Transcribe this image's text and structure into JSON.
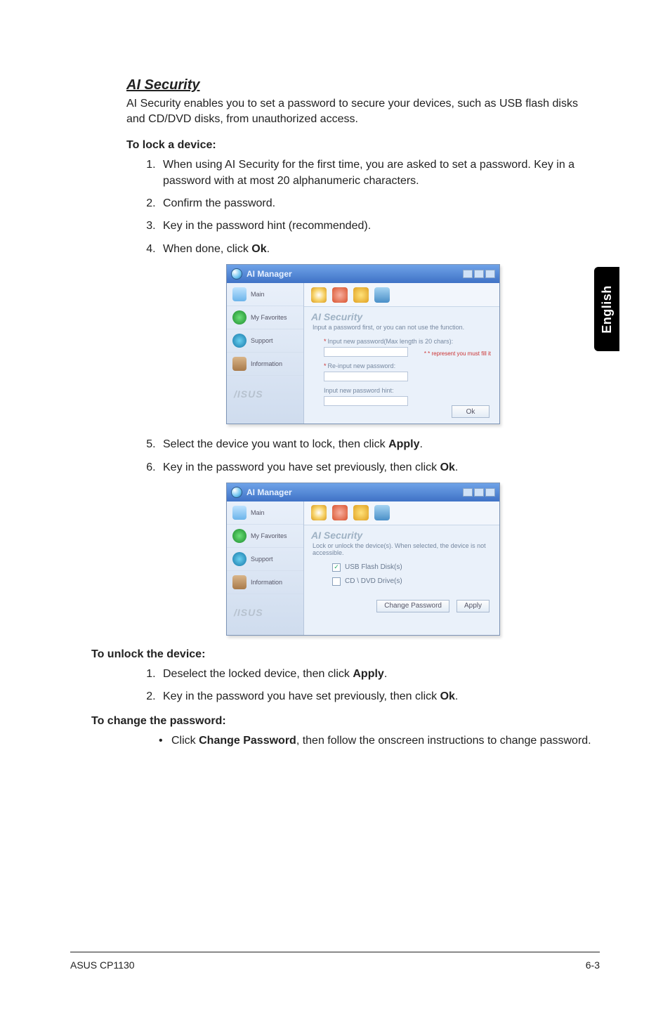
{
  "side_tab": "English",
  "heading": "AI Security",
  "intro": "AI Security enables you to set a password to secure your devices, such as USB flash disks and CD/DVD disks, from unauthorized access.",
  "lock": {
    "title": "To lock a device:",
    "step1": "When using AI Security for the first time, you are asked to set a password. Key in a password with at most 20 alphanumeric characters.",
    "step2": "Confirm the password.",
    "step3": "Key in the password hint (recommended).",
    "step4_pre": "When done, click ",
    "step4_b": "Ok",
    "step4_post": ".",
    "step5_pre": "Select the device you want to lock, then click ",
    "step5_b": "Apply",
    "step5_post": ".",
    "step6_pre": "Key in the password you have set previously, then click ",
    "step6_b": "Ok",
    "step6_post": "."
  },
  "unlock": {
    "title": "To unlock the device:",
    "step1_pre": "Deselect the locked device, then click ",
    "step1_b": "Apply",
    "step1_post": ".",
    "step2_pre": "Key in the password you have set previously, then click ",
    "step2_b": "Ok",
    "step2_post": "."
  },
  "change": {
    "title": "To change the password:",
    "bullet_pre": "Click ",
    "bullet_b": "Change Password",
    "bullet_post": ", then follow the onscreen instructions to change password."
  },
  "shot": {
    "app_title": "AI Manager",
    "side": {
      "main": "Main",
      "fav": "My Favorites",
      "support": "Support",
      "info": "Information"
    },
    "brand": "/ISUS",
    "panel_title": "AI Security",
    "desc1": "Input a password first, or you can not use the function.",
    "f1_label": "Input new password(Max length is 20 chars):",
    "f2_label": "Re-input new password:",
    "f3_label": "Input new password hint:",
    "warn": "* * represent you must fill it",
    "ok": "Ok",
    "desc2": "Lock or unlock the device(s). When selected, the device is not accessible.",
    "chk1": "USB Flash Disk(s)",
    "chk2": "CD \\ DVD Drive(s)",
    "btn_change": "Change Password",
    "btn_apply": "Apply"
  },
  "footer": {
    "left": "ASUS CP1130",
    "right": "6-3"
  }
}
